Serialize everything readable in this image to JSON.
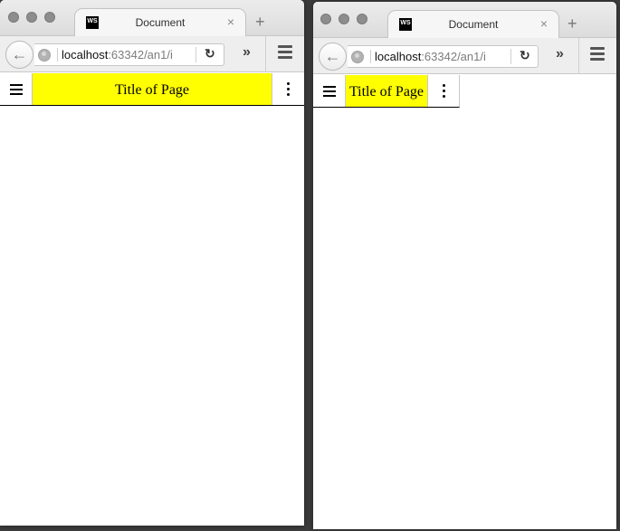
{
  "windows": [
    {
      "tab": {
        "favicon": "WS",
        "title": "Document",
        "close": "×"
      },
      "new_tab": "+",
      "url": {
        "host": "localhost",
        "path": ":63342/an1/i"
      },
      "page": {
        "title": "Title of Page"
      }
    },
    {
      "tab": {
        "favicon": "WS",
        "title": "Document",
        "close": "×"
      },
      "new_tab": "+",
      "url": {
        "host": "localhost",
        "path": ":63342/an1/i"
      },
      "page": {
        "title": "Title of Page"
      }
    }
  ],
  "icons": {
    "back": "back-arrow-icon",
    "globe": "globe-icon",
    "reload": "reload-icon",
    "overflow": "double-chevron-icon",
    "menu": "hamburger-menu-icon",
    "page_menu": "hamburger-icon",
    "page_more": "vertical-dots-icon"
  },
  "colors": {
    "header_accent": "#ffff00"
  }
}
